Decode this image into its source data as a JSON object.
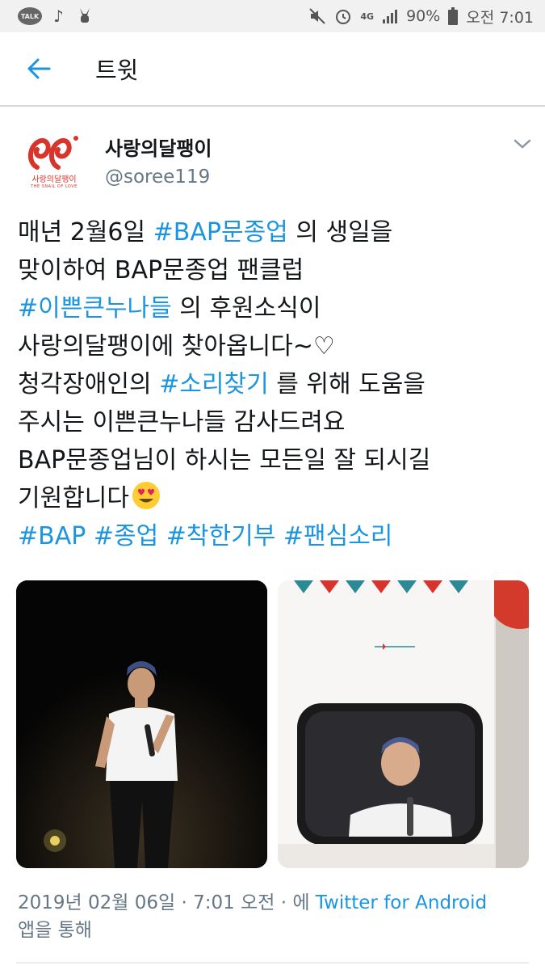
{
  "status_bar": {
    "talk_label": "TALK",
    "network": "4G",
    "battery": "90%",
    "time": "오전 7:01"
  },
  "app_bar": {
    "title": "트윗",
    "back_icon": "arrow-left-icon"
  },
  "tweet": {
    "author_name": "사랑의달팽이",
    "handle": "@soree119",
    "avatar_text": "사랑의달팽이",
    "avatar_subtext": "THE SNAIL OF LOVE",
    "lines": [
      {
        "pre": "매년 2월6일 ",
        "tag": "#BAP문종업",
        "post": " 의 생일을"
      },
      {
        "pre": "맞이하여 BAP문종업 팬클럽",
        "tag": "",
        "post": ""
      },
      {
        "pre": "",
        "tag": "#이쁜큰누나들",
        "post": " 의 후원소식이"
      },
      {
        "pre": "사랑의달팽이에 찾아옵니다~♡",
        "tag": "",
        "post": ""
      },
      {
        "pre": "청각장애인의 ",
        "tag": "#소리찾기",
        "post": " 를 위해 도움을"
      },
      {
        "pre": "주시는 이쁜큰누나들 감사드려요",
        "tag": "",
        "post": ""
      },
      {
        "pre": "BAP문종업님이 하시는 모든일 잘 되시길",
        "tag": "",
        "post": ""
      },
      {
        "pre": "기원합니다",
        "tag": "",
        "post": ""
      }
    ],
    "hashtags": [
      "#BAP",
      "#종업",
      "#착한기부",
      "#팬심소리"
    ],
    "emoji": "heart-eyes-emoji",
    "timestamp": "2019년 02월 06일 · 7:01 오전 · 에",
    "via": "Twitter for Android",
    "via_suffix": "앱을 통해"
  },
  "colors": {
    "link": "#1b95e0",
    "secondary": "#657786",
    "brand_red": "#d9342b"
  }
}
